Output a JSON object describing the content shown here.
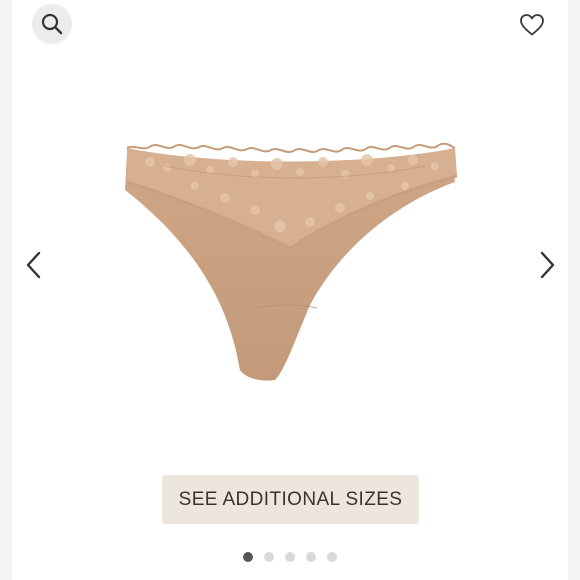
{
  "header": {
    "search_icon": "search-icon",
    "favorite_icon": "heart-icon"
  },
  "gallery": {
    "prev_icon": "chevron-left-icon",
    "next_icon": "chevron-right-icon",
    "image": "product-photo-lace-thong-nude",
    "pagination": {
      "total": 5,
      "active_index": 0
    }
  },
  "sizes_button": {
    "label": "SEE ADDITIONAL SIZES"
  },
  "colors": {
    "product": "#c9a181",
    "lace": "#d4ad8b",
    "button_bg": "#ede6dd",
    "dot_active": "#565656",
    "dot_inactive": "#d9d9d9"
  }
}
